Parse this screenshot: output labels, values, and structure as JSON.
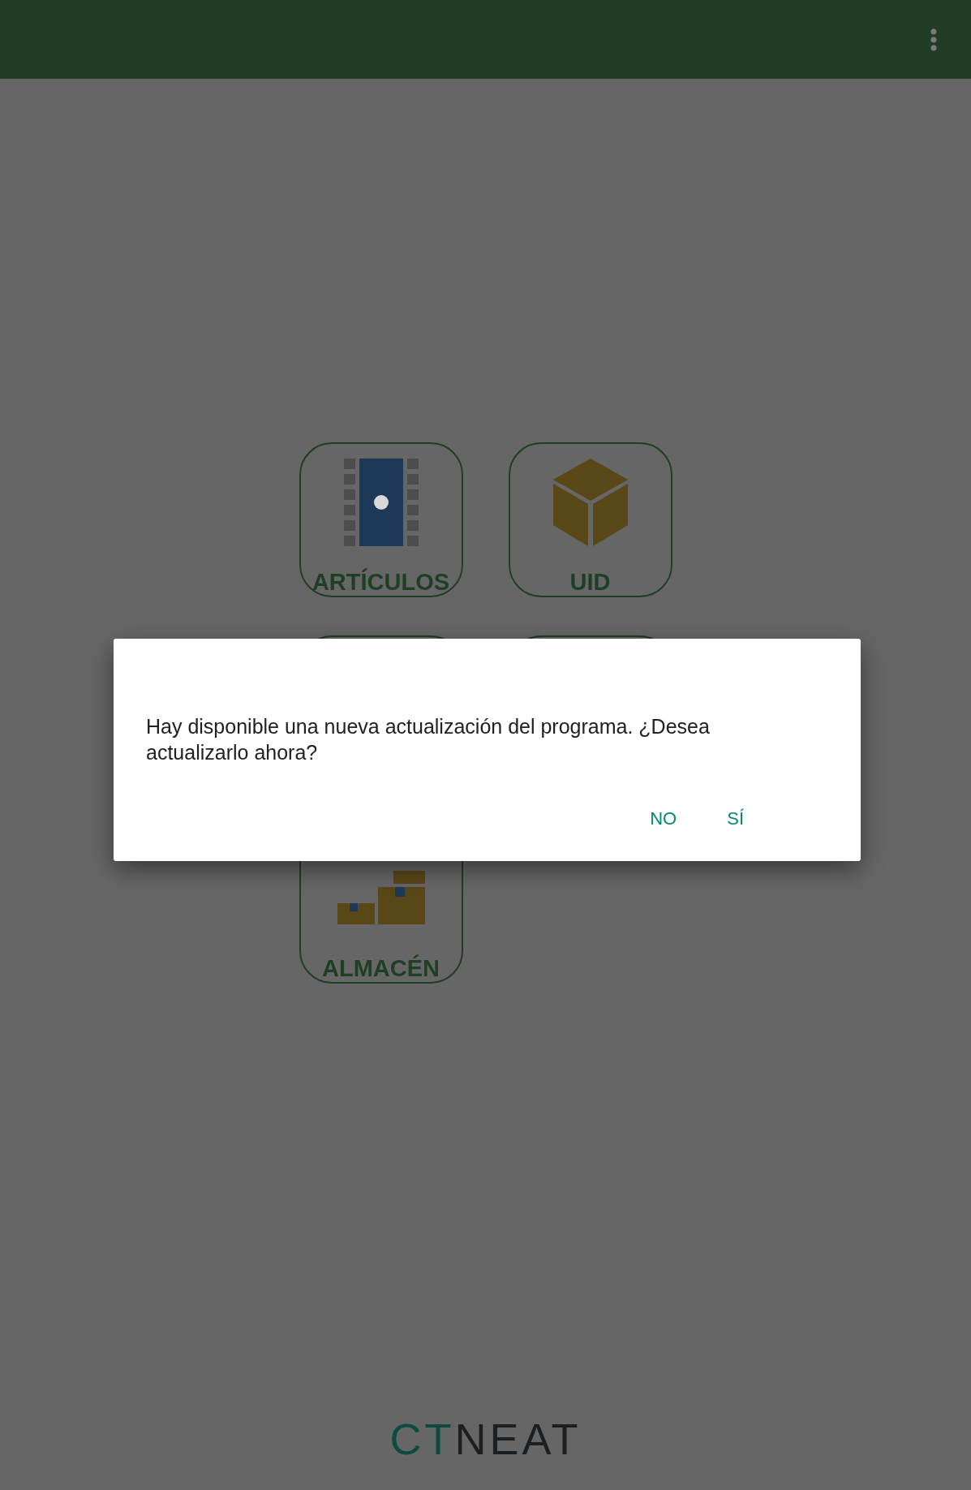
{
  "tiles": [
    {
      "kind": "film",
      "label": "ARTÍCULOS"
    },
    {
      "kind": "cube",
      "label": "UID"
    },
    {
      "kind": "covered"
    },
    {
      "kind": "covered"
    },
    {
      "kind": "boxes",
      "label": "ALMACÉN"
    }
  ],
  "dialog": {
    "message": "Hay disponible una nueva actualización del programa. ¿Desea actualizarlo ahora?",
    "buttons": [
      "NO",
      "SÍ"
    ]
  },
  "logo": {
    "part_1": "CT",
    "part_2": "NEAT"
  }
}
